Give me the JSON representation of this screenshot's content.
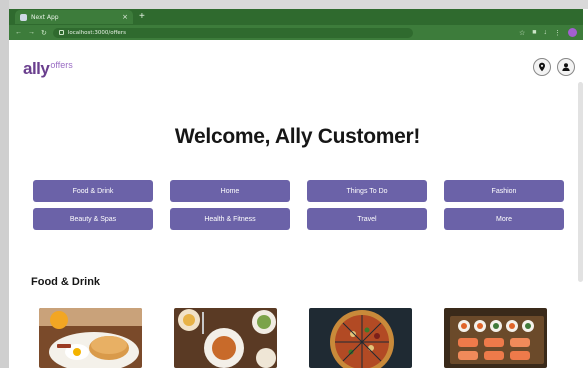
{
  "browser": {
    "tab_title": "Next App",
    "tab_close": "×",
    "new_tab": "+",
    "url": "localhost:3000/offers",
    "nav_icons": [
      "back-icon",
      "forward-icon",
      "reload-icon"
    ],
    "toolbar_icons": [
      "star-icon",
      "extensions-icon",
      "download-icon",
      "menu-icon"
    ],
    "colors": {
      "tab_bar": "#2f6a2e",
      "toolbar": "#3d7c3b"
    }
  },
  "header": {
    "logo_main": "ally",
    "logo_sub": "offers",
    "icons": [
      "location-pin-icon",
      "user-account-icon"
    ]
  },
  "welcome": "Welcome, Ally Customer!",
  "categories": [
    "Food & Drink",
    "Home",
    "Things To Do",
    "Fashion",
    "Beauty & Spas",
    "Health & Fitness",
    "Travel",
    "More"
  ],
  "section": {
    "title": "Food & Drink",
    "cards": [
      "breakfast-plate-image",
      "brunch-table-image",
      "pizza-image",
      "sushi-platter-image"
    ]
  },
  "colors": {
    "brand_purple": "#6a3f8e",
    "button": "#6b62a8",
    "text": "#161616"
  }
}
